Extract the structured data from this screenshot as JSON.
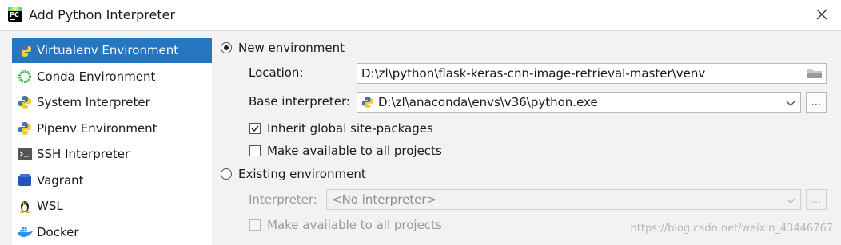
{
  "window": {
    "title": "Add Python Interpreter",
    "app_icon_text": "PC"
  },
  "sidebar": {
    "items": [
      {
        "label": "Virtualenv Environment",
        "icon": "python-virtualenv-icon",
        "selected": true
      },
      {
        "label": "Conda Environment",
        "icon": "conda-ring-icon"
      },
      {
        "label": "System Interpreter",
        "icon": "python-icon"
      },
      {
        "label": "Pipenv Environment",
        "icon": "pipenv-icon"
      },
      {
        "label": "SSH Interpreter",
        "icon": "terminal-icon"
      },
      {
        "label": "Vagrant",
        "icon": "vagrant-icon"
      },
      {
        "label": "WSL",
        "icon": "linux-penguin-icon"
      },
      {
        "label": "Docker",
        "icon": "docker-whale-icon"
      }
    ]
  },
  "new_env": {
    "radio_label": "New environment",
    "location_label": "Location:",
    "location_value": "D:\\zl\\python\\flask-keras-cnn-image-retrieval-master\\venv",
    "base_label": "Base interpreter:",
    "base_value": "D:\\zl\\anaconda\\envs\\v36\\python.exe",
    "ellipsis": "...",
    "inherit_label": "Inherit global site-packages",
    "inherit_checked": true,
    "make_available_label": "Make available to all projects",
    "make_available_checked": false
  },
  "existing_env": {
    "radio_label": "Existing environment",
    "interpreter_label": "Interpreter:",
    "interpreter_value": "<No interpreter>",
    "ellipsis": "...",
    "make_available_label": "Make available to all projects"
  },
  "watermark": "https://blog.csdn.net/weixin_43446767",
  "colors": {
    "selection": "#2675bf",
    "panel": "#f2f2f2"
  }
}
